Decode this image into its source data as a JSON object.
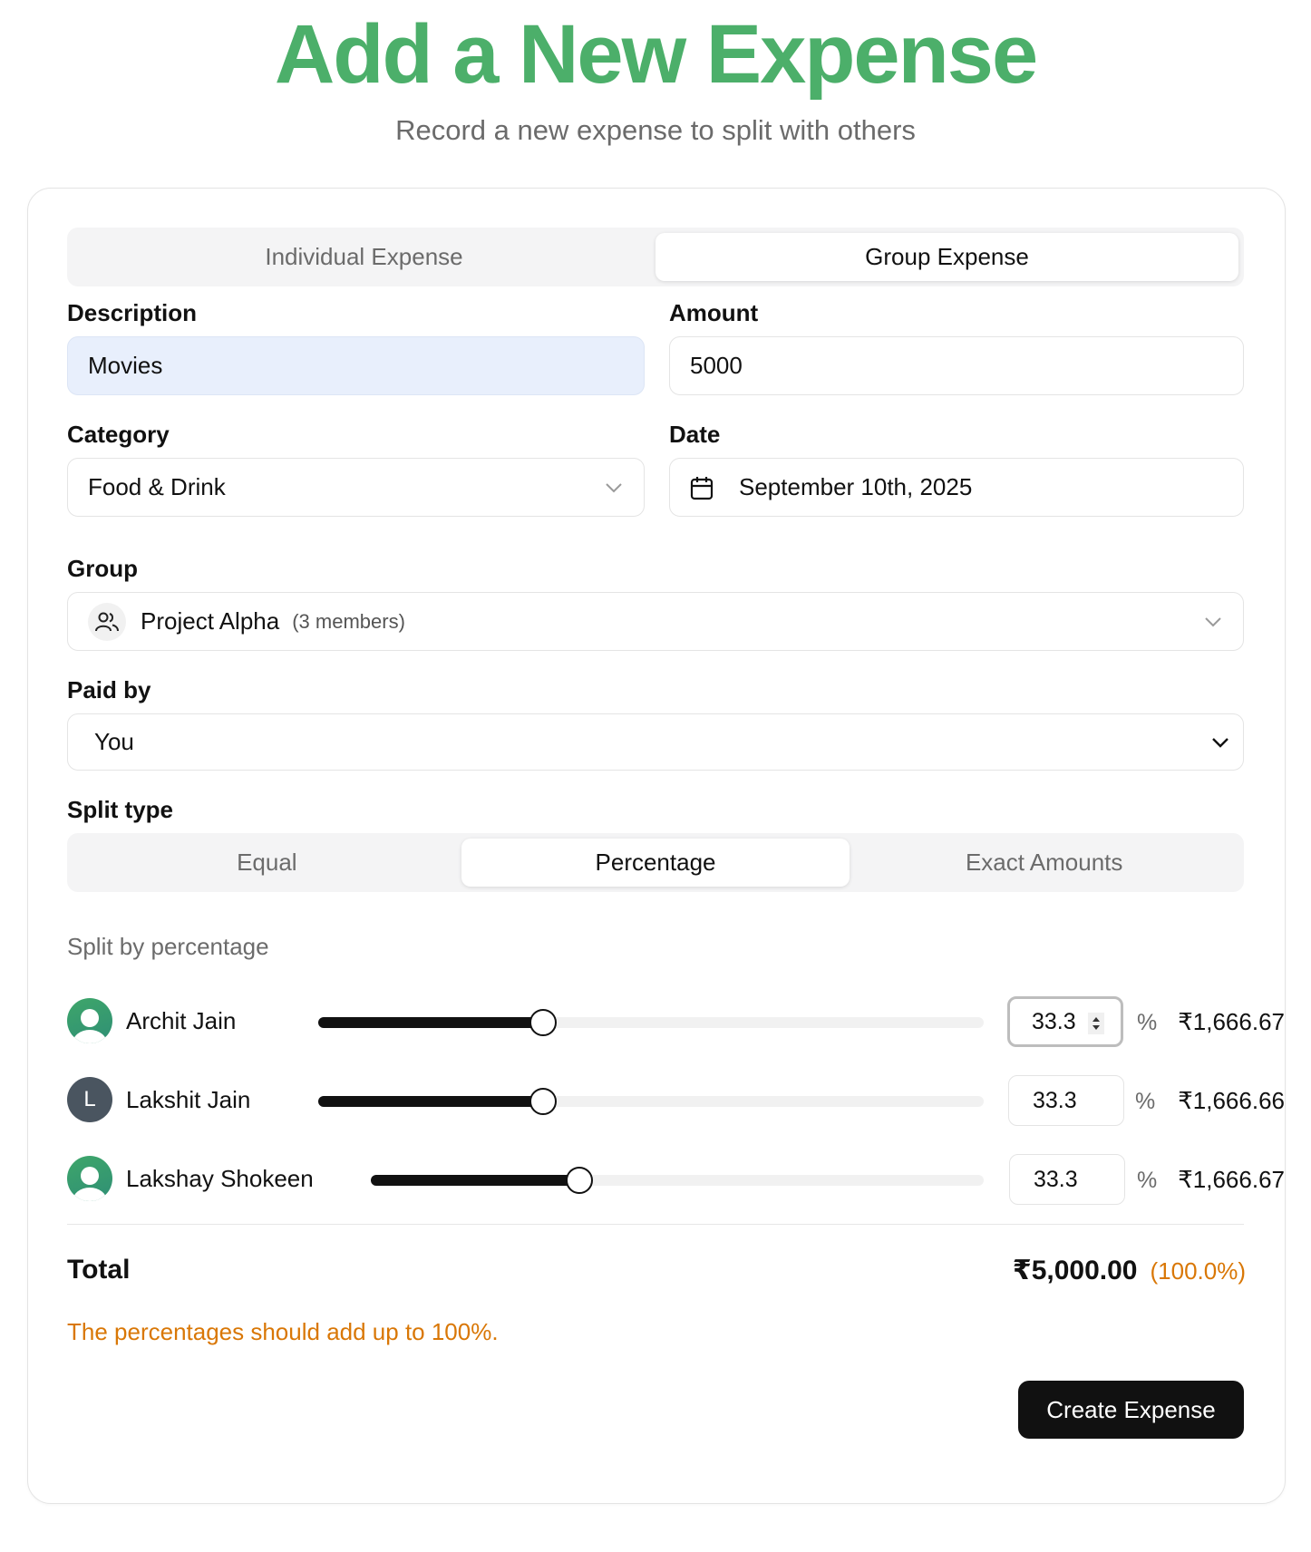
{
  "header": {
    "title": "Add a New Expense",
    "subtitle": "Record a new expense to split with others"
  },
  "expense_type": {
    "tabs": [
      "Individual Expense",
      "Group Expense"
    ],
    "active": "Group Expense"
  },
  "description": {
    "label": "Description",
    "value": "Movies"
  },
  "amount": {
    "label": "Amount",
    "value": "5000"
  },
  "category": {
    "label": "Category",
    "value": "Food & Drink"
  },
  "date": {
    "label": "Date",
    "value": "September 10th, 2025"
  },
  "group": {
    "label": "Group",
    "value": "Project Alpha",
    "members": "(3 members)"
  },
  "paid_by": {
    "label": "Paid by",
    "value": "You"
  },
  "split_type": {
    "label": "Split type",
    "tabs": [
      "Equal",
      "Percentage",
      "Exact Amounts"
    ],
    "active": "Percentage"
  },
  "split": {
    "hint": "Split by percentage",
    "people": [
      {
        "name": "Archit Jain",
        "avatar": "person-photo",
        "percentage": "33.3",
        "percent_fraction": 0.333,
        "amount": "₹1,666.67"
      },
      {
        "name": "Lakshit Jain",
        "avatar_initial": "L",
        "percentage": "33.3",
        "percent_fraction": 0.333,
        "amount": "₹1,666.66"
      },
      {
        "name": "Lakshay Shokeen",
        "avatar": "person-photo",
        "percentage": "33.3",
        "percent_fraction": 0.333,
        "amount": "₹1,666.67"
      }
    ],
    "percent_symbol": "%"
  },
  "total": {
    "label": "Total",
    "amount": "₹5,000.00",
    "percentage": "(100.0%)"
  },
  "warning": "The percentages should add up to 100%.",
  "submit_label": "Create Expense",
  "colors": {
    "title_green": "#4caf6a",
    "warning_orange": "#d97706",
    "primary_button": "#111111",
    "filled_input": "#e8effc"
  }
}
